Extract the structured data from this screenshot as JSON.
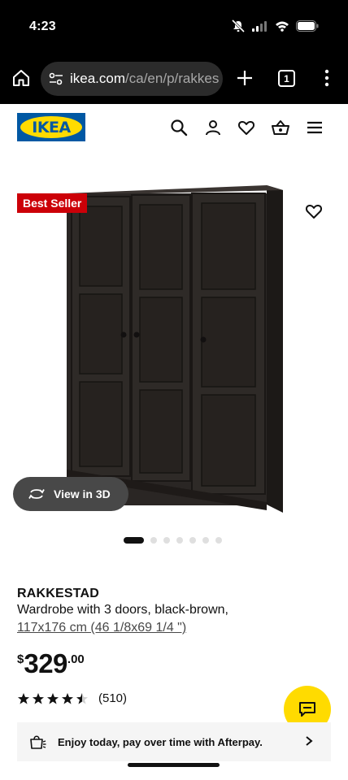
{
  "status_bar": {
    "time": "4:23"
  },
  "browser": {
    "url_domain": "ikea.com",
    "url_path": "/ca/en/p/rakkes",
    "tab_count": "1"
  },
  "site": {
    "logo_text": "IKEA"
  },
  "icons": {
    "home": "home-icon",
    "tune": "site-settings-icon",
    "plus": "new-tab-icon",
    "more": "more-vertical-icon",
    "search": "search-icon",
    "account": "user-icon",
    "wishlist": "heart-icon",
    "cart": "shopping-basket-icon",
    "menu": "menu-icon",
    "rotate": "rotate-3d-icon",
    "star": "star-icon",
    "chat": "chat-icon",
    "afterpay": "shopping-bag-icon",
    "chevron": "chevron-right-icon"
  },
  "product": {
    "badge": "Best Seller",
    "view3d_label": "View in 3D",
    "gallery_count": 7,
    "gallery_active": 0,
    "name": "RAKKESTAD",
    "description": "Wardrobe with 3 doors, black-brown,",
    "size": "117x176 cm (46 1/8x69 1/4 \")",
    "price": {
      "currency": "$",
      "whole": "329",
      "cents": ".00"
    },
    "rating": {
      "value": 4.5,
      "max": 5,
      "count": "(510)"
    },
    "afterpay_text": "Enjoy today, pay over time with Afterpay."
  },
  "colors": {
    "ikea_blue": "#0058a3",
    "ikea_yellow": "#ffdb00",
    "badge_red": "#cc0008",
    "wardrobe": "#2a2624"
  }
}
